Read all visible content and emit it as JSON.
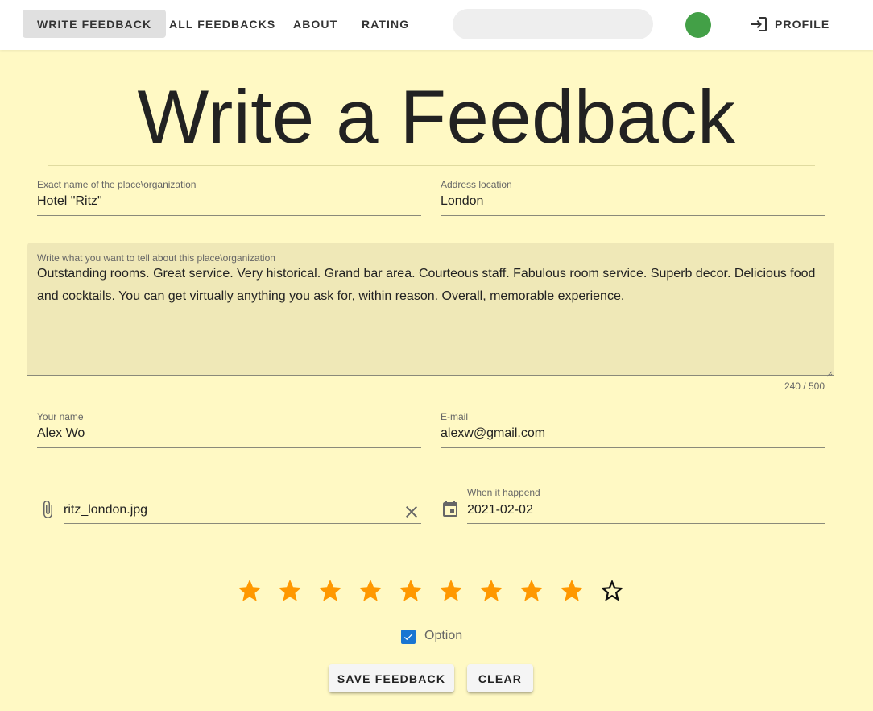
{
  "nav": {
    "items": [
      {
        "label": "WRITE FEEDBACK"
      },
      {
        "label": "ALL FEEDBACKS"
      },
      {
        "label": "ABOUT"
      },
      {
        "label": "RATING"
      }
    ],
    "search_value": "",
    "status_color": "#43a047",
    "profile_label": "PROFILE",
    "profile_icon": "login-icon"
  },
  "page": {
    "title": "Write a Feedback"
  },
  "form": {
    "place": {
      "label": "Exact name of the place\\organization",
      "value": "Hotel \"Ritz\""
    },
    "address": {
      "label": "Address location",
      "value": "London"
    },
    "description": {
      "label": "Write what you want to tell about this place\\organization",
      "value": "Outstanding rooms. Great service. Very historical. Grand bar area. Courteous staff. Fabulous room service. Superb decor. Delicious food and cocktails. You can get virtually anything you ask for, within reason. Overall, memorable experience.",
      "counter": "240 / 500"
    },
    "name": {
      "label": "Your name",
      "value": "Alex Wo"
    },
    "email": {
      "label": "E-mail",
      "value": "alexw@gmail.com"
    },
    "file": {
      "value": "ritz_london.jpg",
      "icon": "paperclip-icon",
      "clear_icon": "close-icon"
    },
    "date": {
      "label": "When it happend",
      "value": "2021-02-02",
      "icon": "calendar-icon"
    },
    "rating": {
      "value": 9,
      "max": 10,
      "filled_color": "#ff9800"
    },
    "option": {
      "label": "Option",
      "checked": true,
      "color": "#1976d2"
    },
    "buttons": {
      "save": "SAVE FEEDBACK",
      "clear": "CLEAR"
    }
  }
}
